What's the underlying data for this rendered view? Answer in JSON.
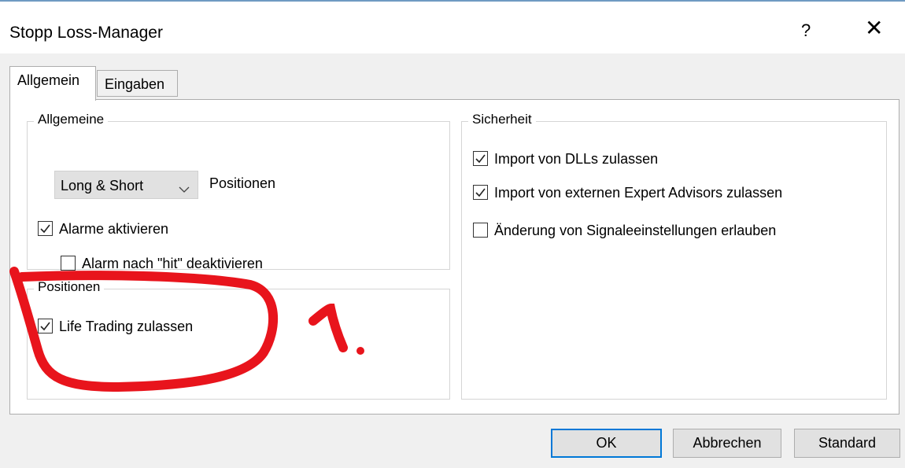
{
  "window": {
    "title": "Stopp Loss-Manager",
    "help_label": "?",
    "close_label": "✕"
  },
  "tabs": [
    {
      "label": "Allgemein",
      "active": true
    },
    {
      "label": "Eingaben",
      "active": false
    }
  ],
  "general_group": {
    "title": "Allgemeine",
    "dropdown_value": "Long & Short",
    "dropdown_suffix": "Positionen",
    "checkboxes": [
      {
        "label": "Alarme aktivieren",
        "checked": true
      },
      {
        "label": "Alarm nach \"hit\" deaktivieren",
        "checked": false
      }
    ]
  },
  "positions_group": {
    "title": "Positionen",
    "checkboxes": [
      {
        "label": "Life Trading zulassen",
        "checked": true
      }
    ]
  },
  "security_group": {
    "title": "Sicherheit",
    "checkboxes": [
      {
        "label": "Import von DLLs zulassen",
        "checked": true
      },
      {
        "label": "Import von externen Expert Advisors zulassen",
        "checked": true
      },
      {
        "label": "Änderung von Signaleeinstellungen erlauben",
        "checked": false
      }
    ]
  },
  "buttons": {
    "ok": "OK",
    "cancel": "Abbrechen",
    "standard": "Standard"
  },
  "colors": {
    "accent": "#0078d7",
    "annotation": "#e8141c"
  }
}
